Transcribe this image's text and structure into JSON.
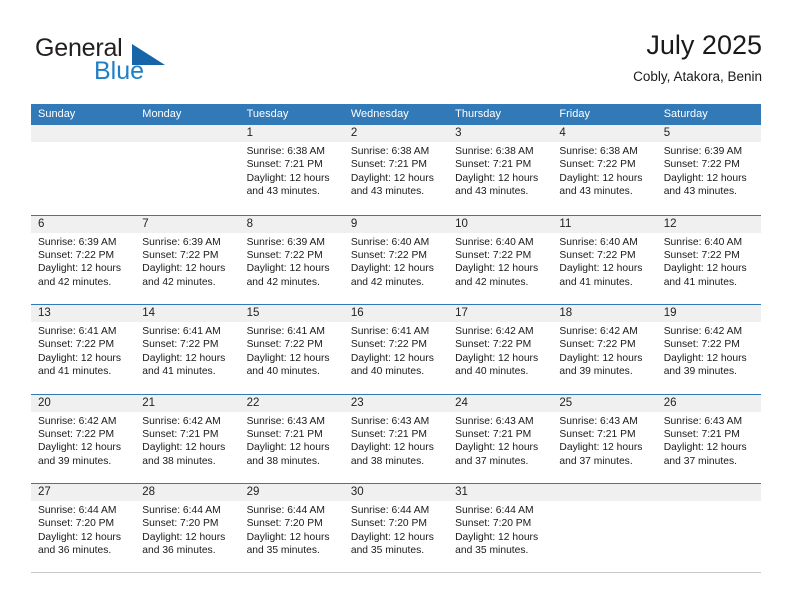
{
  "brand": {
    "name_part1": "General",
    "name_part2": "Blue",
    "triangle_color": "#1565a8",
    "blue_color": "#1f7fc4"
  },
  "header": {
    "title": "July 2025",
    "subtitle": "Cobly, Atakora, Benin"
  },
  "theme": {
    "header_blue": "#3279b7",
    "daynum_band": "#f0f0f0",
    "row_divider": "#3279b7"
  },
  "weekday_headers": [
    "Sunday",
    "Monday",
    "Tuesday",
    "Wednesday",
    "Thursday",
    "Friday",
    "Saturday"
  ],
  "weeks": [
    [
      {
        "day": "",
        "sunrise": "",
        "sunset": "",
        "daylight_line1": "",
        "daylight_line2": ""
      },
      {
        "day": "",
        "sunrise": "",
        "sunset": "",
        "daylight_line1": "",
        "daylight_line2": ""
      },
      {
        "day": "1",
        "sunrise": "Sunrise: 6:38 AM",
        "sunset": "Sunset: 7:21 PM",
        "daylight_line1": "Daylight: 12 hours",
        "daylight_line2": "and 43 minutes."
      },
      {
        "day": "2",
        "sunrise": "Sunrise: 6:38 AM",
        "sunset": "Sunset: 7:21 PM",
        "daylight_line1": "Daylight: 12 hours",
        "daylight_line2": "and 43 minutes."
      },
      {
        "day": "3",
        "sunrise": "Sunrise: 6:38 AM",
        "sunset": "Sunset: 7:21 PM",
        "daylight_line1": "Daylight: 12 hours",
        "daylight_line2": "and 43 minutes."
      },
      {
        "day": "4",
        "sunrise": "Sunrise: 6:38 AM",
        "sunset": "Sunset: 7:22 PM",
        "daylight_line1": "Daylight: 12 hours",
        "daylight_line2": "and 43 minutes."
      },
      {
        "day": "5",
        "sunrise": "Sunrise: 6:39 AM",
        "sunset": "Sunset: 7:22 PM",
        "daylight_line1": "Daylight: 12 hours",
        "daylight_line2": "and 43 minutes."
      }
    ],
    [
      {
        "day": "6",
        "sunrise": "Sunrise: 6:39 AM",
        "sunset": "Sunset: 7:22 PM",
        "daylight_line1": "Daylight: 12 hours",
        "daylight_line2": "and 42 minutes."
      },
      {
        "day": "7",
        "sunrise": "Sunrise: 6:39 AM",
        "sunset": "Sunset: 7:22 PM",
        "daylight_line1": "Daylight: 12 hours",
        "daylight_line2": "and 42 minutes."
      },
      {
        "day": "8",
        "sunrise": "Sunrise: 6:39 AM",
        "sunset": "Sunset: 7:22 PM",
        "daylight_line1": "Daylight: 12 hours",
        "daylight_line2": "and 42 minutes."
      },
      {
        "day": "9",
        "sunrise": "Sunrise: 6:40 AM",
        "sunset": "Sunset: 7:22 PM",
        "daylight_line1": "Daylight: 12 hours",
        "daylight_line2": "and 42 minutes."
      },
      {
        "day": "10",
        "sunrise": "Sunrise: 6:40 AM",
        "sunset": "Sunset: 7:22 PM",
        "daylight_line1": "Daylight: 12 hours",
        "daylight_line2": "and 42 minutes."
      },
      {
        "day": "11",
        "sunrise": "Sunrise: 6:40 AM",
        "sunset": "Sunset: 7:22 PM",
        "daylight_line1": "Daylight: 12 hours",
        "daylight_line2": "and 41 minutes."
      },
      {
        "day": "12",
        "sunrise": "Sunrise: 6:40 AM",
        "sunset": "Sunset: 7:22 PM",
        "daylight_line1": "Daylight: 12 hours",
        "daylight_line2": "and 41 minutes."
      }
    ],
    [
      {
        "day": "13",
        "sunrise": "Sunrise: 6:41 AM",
        "sunset": "Sunset: 7:22 PM",
        "daylight_line1": "Daylight: 12 hours",
        "daylight_line2": "and 41 minutes."
      },
      {
        "day": "14",
        "sunrise": "Sunrise: 6:41 AM",
        "sunset": "Sunset: 7:22 PM",
        "daylight_line1": "Daylight: 12 hours",
        "daylight_line2": "and 41 minutes."
      },
      {
        "day": "15",
        "sunrise": "Sunrise: 6:41 AM",
        "sunset": "Sunset: 7:22 PM",
        "daylight_line1": "Daylight: 12 hours",
        "daylight_line2": "and 40 minutes."
      },
      {
        "day": "16",
        "sunrise": "Sunrise: 6:41 AM",
        "sunset": "Sunset: 7:22 PM",
        "daylight_line1": "Daylight: 12 hours",
        "daylight_line2": "and 40 minutes."
      },
      {
        "day": "17",
        "sunrise": "Sunrise: 6:42 AM",
        "sunset": "Sunset: 7:22 PM",
        "daylight_line1": "Daylight: 12 hours",
        "daylight_line2": "and 40 minutes."
      },
      {
        "day": "18",
        "sunrise": "Sunrise: 6:42 AM",
        "sunset": "Sunset: 7:22 PM",
        "daylight_line1": "Daylight: 12 hours",
        "daylight_line2": "and 39 minutes."
      },
      {
        "day": "19",
        "sunrise": "Sunrise: 6:42 AM",
        "sunset": "Sunset: 7:22 PM",
        "daylight_line1": "Daylight: 12 hours",
        "daylight_line2": "and 39 minutes."
      }
    ],
    [
      {
        "day": "20",
        "sunrise": "Sunrise: 6:42 AM",
        "sunset": "Sunset: 7:22 PM",
        "daylight_line1": "Daylight: 12 hours",
        "daylight_line2": "and 39 minutes."
      },
      {
        "day": "21",
        "sunrise": "Sunrise: 6:42 AM",
        "sunset": "Sunset: 7:21 PM",
        "daylight_line1": "Daylight: 12 hours",
        "daylight_line2": "and 38 minutes."
      },
      {
        "day": "22",
        "sunrise": "Sunrise: 6:43 AM",
        "sunset": "Sunset: 7:21 PM",
        "daylight_line1": "Daylight: 12 hours",
        "daylight_line2": "and 38 minutes."
      },
      {
        "day": "23",
        "sunrise": "Sunrise: 6:43 AM",
        "sunset": "Sunset: 7:21 PM",
        "daylight_line1": "Daylight: 12 hours",
        "daylight_line2": "and 38 minutes."
      },
      {
        "day": "24",
        "sunrise": "Sunrise: 6:43 AM",
        "sunset": "Sunset: 7:21 PM",
        "daylight_line1": "Daylight: 12 hours",
        "daylight_line2": "and 37 minutes."
      },
      {
        "day": "25",
        "sunrise": "Sunrise: 6:43 AM",
        "sunset": "Sunset: 7:21 PM",
        "daylight_line1": "Daylight: 12 hours",
        "daylight_line2": "and 37 minutes."
      },
      {
        "day": "26",
        "sunrise": "Sunrise: 6:43 AM",
        "sunset": "Sunset: 7:21 PM",
        "daylight_line1": "Daylight: 12 hours",
        "daylight_line2": "and 37 minutes."
      }
    ],
    [
      {
        "day": "27",
        "sunrise": "Sunrise: 6:44 AM",
        "sunset": "Sunset: 7:20 PM",
        "daylight_line1": "Daylight: 12 hours",
        "daylight_line2": "and 36 minutes."
      },
      {
        "day": "28",
        "sunrise": "Sunrise: 6:44 AM",
        "sunset": "Sunset: 7:20 PM",
        "daylight_line1": "Daylight: 12 hours",
        "daylight_line2": "and 36 minutes."
      },
      {
        "day": "29",
        "sunrise": "Sunrise: 6:44 AM",
        "sunset": "Sunset: 7:20 PM",
        "daylight_line1": "Daylight: 12 hours",
        "daylight_line2": "and 35 minutes."
      },
      {
        "day": "30",
        "sunrise": "Sunrise: 6:44 AM",
        "sunset": "Sunset: 7:20 PM",
        "daylight_line1": "Daylight: 12 hours",
        "daylight_line2": "and 35 minutes."
      },
      {
        "day": "31",
        "sunrise": "Sunrise: 6:44 AM",
        "sunset": "Sunset: 7:20 PM",
        "daylight_line1": "Daylight: 12 hours",
        "daylight_line2": "and 35 minutes."
      },
      {
        "day": "",
        "sunrise": "",
        "sunset": "",
        "daylight_line1": "",
        "daylight_line2": ""
      },
      {
        "day": "",
        "sunrise": "",
        "sunset": "",
        "daylight_line1": "",
        "daylight_line2": ""
      }
    ]
  ]
}
